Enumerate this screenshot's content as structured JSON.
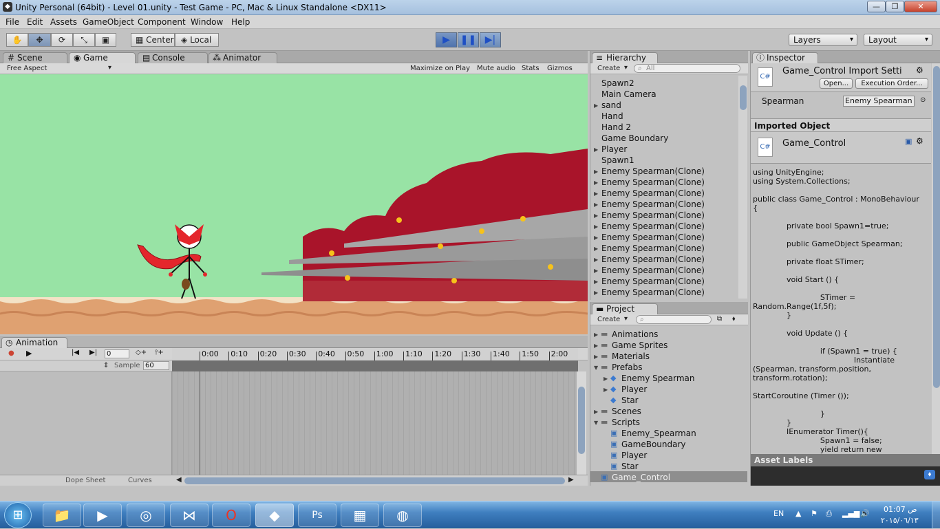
{
  "window": {
    "title": "Unity Personal (64bit) - Level 01.unity - Test Game - PC, Mac & Linux Standalone <DX11>",
    "min": "—",
    "max": "❐",
    "close": "✕"
  },
  "menu": [
    "File",
    "Edit",
    "Assets",
    "GameObject",
    "Component",
    "Window",
    "Help"
  ],
  "toolbar": {
    "pivot": "Center",
    "space": "Local",
    "layers": "Layers",
    "layout": "Layout"
  },
  "tabs": {
    "scene": "Scene",
    "game": "Game",
    "console": "Console",
    "animator": "Animator",
    "animation": "Animation",
    "hierarchy": "Hierarchy",
    "project": "Project",
    "inspector": "Inspector"
  },
  "game_bar": {
    "aspect": "Free Aspect",
    "maximize": "Maximize on Play",
    "mute": "Mute audio",
    "stats": "Stats",
    "gizmos": "Gizmos"
  },
  "animation": {
    "frame": "0",
    "sample_label": "Sample",
    "sample_value": "60",
    "ticks": [
      "0:00",
      "0:10",
      "0:20",
      "0:30",
      "0:40",
      "0:50",
      "1:00",
      "1:10",
      "1:20",
      "1:30",
      "1:40",
      "1:50",
      "2:00"
    ],
    "dope_sheet": "Dope Sheet",
    "curves": "Curves"
  },
  "hierarchy": {
    "create": "Create",
    "search_placeholder": "All",
    "items": [
      {
        "label": "Spawn2",
        "arrow": ""
      },
      {
        "label": "Main Camera",
        "arrow": ""
      },
      {
        "label": "sand",
        "arrow": "▶"
      },
      {
        "label": "Hand",
        "arrow": ""
      },
      {
        "label": "Hand 2",
        "arrow": ""
      },
      {
        "label": "Game Boundary",
        "arrow": ""
      },
      {
        "label": "Player",
        "arrow": "▶"
      },
      {
        "label": "Spawn1",
        "arrow": ""
      },
      {
        "label": "Enemy Spearman(Clone)",
        "arrow": "▶"
      },
      {
        "label": "Enemy Spearman(Clone)",
        "arrow": "▶"
      },
      {
        "label": "Enemy Spearman(Clone)",
        "arrow": "▶"
      },
      {
        "label": "Enemy Spearman(Clone)",
        "arrow": "▶"
      },
      {
        "label": "Enemy Spearman(Clone)",
        "arrow": "▶"
      },
      {
        "label": "Enemy Spearman(Clone)",
        "arrow": "▶"
      },
      {
        "label": "Enemy Spearman(Clone)",
        "arrow": "▶"
      },
      {
        "label": "Enemy Spearman(Clone)",
        "arrow": "▶"
      },
      {
        "label": "Enemy Spearman(Clone)",
        "arrow": "▶"
      },
      {
        "label": "Enemy Spearman(Clone)",
        "arrow": "▶"
      },
      {
        "label": "Enemy Spearman(Clone)",
        "arrow": "▶"
      },
      {
        "label": "Enemy Spearman(Clone)",
        "arrow": "▶"
      }
    ]
  },
  "project": {
    "create": "Create",
    "items": [
      {
        "label": "Animations",
        "type": "folder",
        "arrow": "▶",
        "indent": 0
      },
      {
        "label": "Game Sprites",
        "type": "folder",
        "arrow": "▶",
        "indent": 0
      },
      {
        "label": "Materials",
        "type": "folder",
        "arrow": "▶",
        "indent": 0
      },
      {
        "label": "Prefabs",
        "type": "folder",
        "arrow": "▼",
        "indent": 0
      },
      {
        "label": "Enemy Spearman",
        "type": "prefab",
        "arrow": "▶",
        "indent": 1
      },
      {
        "label": "Player",
        "type": "prefab",
        "arrow": "▶",
        "indent": 1
      },
      {
        "label": "Star",
        "type": "prefab",
        "arrow": "",
        "indent": 1
      },
      {
        "label": "Scenes",
        "type": "folder",
        "arrow": "▶",
        "indent": 0
      },
      {
        "label": "Scripts",
        "type": "folder",
        "arrow": "▼",
        "indent": 0
      },
      {
        "label": "Enemy_Spearman",
        "type": "script",
        "arrow": "",
        "indent": 1
      },
      {
        "label": "GameBoundary",
        "type": "script",
        "arrow": "",
        "indent": 1
      },
      {
        "label": "Player",
        "type": "script",
        "arrow": "",
        "indent": 1
      },
      {
        "label": "Star",
        "type": "script",
        "arrow": "",
        "indent": 1
      },
      {
        "label": "Game_Control",
        "type": "script",
        "arrow": "",
        "indent": 0
      }
    ]
  },
  "inspector": {
    "title": "Game_Control Import Setti",
    "open": "Open...",
    "exec_order": "Execution Order...",
    "field_label": "Spearman",
    "field_value": "Enemy Spearman",
    "imported": "Imported Object",
    "object_name": "Game_Control",
    "code": "using UnityEngine;\nusing System.Collections;\n\npublic class Game_Control : MonoBehaviour\n{\n\n              private bool Spawn1=true;\n\n              public GameObject Spearman;\n\n              private float STimer;\n\n              void Start () {\n\n                            STimer =\nRandom.Range(1f,5f);\n              }\n\n              void Update () {\n\n                            if (Spawn1 = true) {\n                                          Instantiate\n(Spearman, transform.position,\ntransform.rotation);\n\nStartCoroutine (Timer ());\n\n                            }\n              }\n              IEnumerator Timer(){\n                            Spawn1 = false;\n                            yield return new",
    "asset_labels": "Asset Labels"
  },
  "taskbar": {
    "lang": "EN",
    "time": "01:07 ص",
    "date": "٢٠١٥/٠٦/١٣"
  },
  "colors": {
    "sky": "#98e3a5",
    "sand": "#dfa171",
    "enemy": "#a9142a",
    "scarf": "#e4262c"
  }
}
